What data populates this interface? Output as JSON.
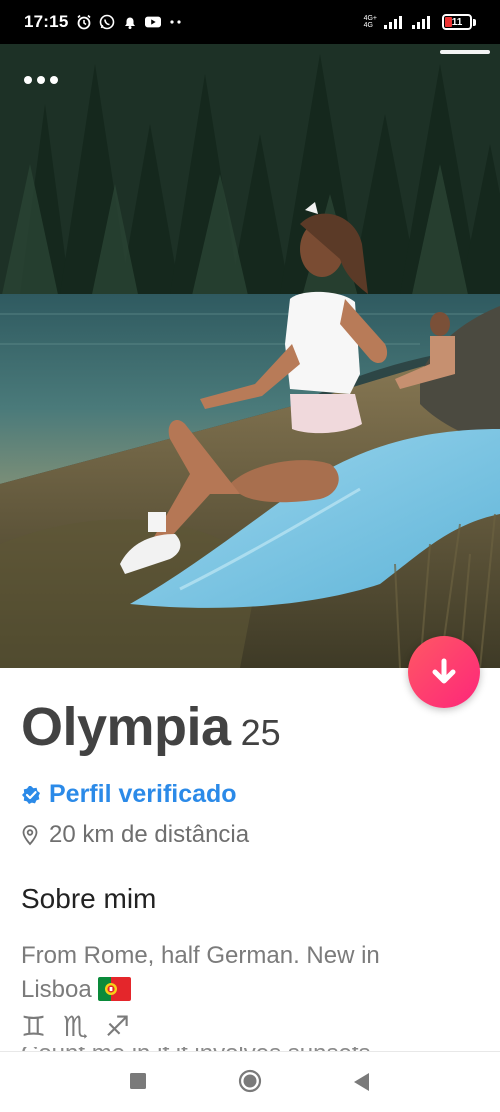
{
  "status_bar": {
    "time": "17:15",
    "network_label_top": "4G+",
    "network_label_bottom": "4G",
    "battery_level": "11",
    "icons": [
      "alarm-icon",
      "whatsapp-icon",
      "notification-bell-icon",
      "youtube-icon",
      "more-notifications-icon",
      "signal-icon",
      "signal-icon",
      "battery-icon"
    ]
  },
  "photo": {
    "description_icon": "more-options-icon",
    "active_photo_index": 1,
    "photo_count": 1
  },
  "profile": {
    "name": "Olympia",
    "age": "25",
    "verified_label": "Perfil verificado",
    "distance_label": "20 km de distância",
    "about_title": "Sobre mim",
    "bio_line1": "From Rome, half German. New in",
    "bio_line2": "Lisboa",
    "zodiac_signs": "♊ ♏ ♐",
    "bio_cut_line": "Count me in if it involves sunsets"
  },
  "colors": {
    "accent_gradient_start": "#ff5864",
    "accent_gradient_end": "#fd267a",
    "verified_blue": "#2b8ae8",
    "name_text": "#424242"
  },
  "nav": {
    "icons": [
      "recents-square-icon",
      "home-circle-icon",
      "back-triangle-icon"
    ]
  }
}
